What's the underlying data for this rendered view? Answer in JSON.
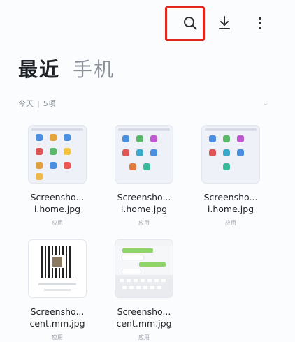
{
  "toolbar": {
    "icons": [
      "search-icon",
      "download-icon",
      "more-vertical-icon"
    ],
    "highlight_color": "#e3271f"
  },
  "tabs": [
    {
      "label": "最近",
      "active": true
    },
    {
      "label": "手机",
      "active": false
    }
  ],
  "group": {
    "date": "今天",
    "separator": "|",
    "count": "5项"
  },
  "files": [
    {
      "name_line1": "Screensho...",
      "name_line2": "i.home.jpg",
      "source": "应用",
      "thumb": "home-screen"
    },
    {
      "name_line1": "Screensho...",
      "name_line2": "i.home.jpg",
      "source": "应用",
      "thumb": "home-screen"
    },
    {
      "name_line1": "Screensho...",
      "name_line2": "i.home.jpg",
      "source": "应用",
      "thumb": "home-screen"
    },
    {
      "name_line1": "Screensho...",
      "name_line2": "cent.mm.jpg",
      "source": "应用",
      "thumb": "qr-code"
    },
    {
      "name_line1": "Screensho...",
      "name_line2": "cent.mm.jpg",
      "source": "应用",
      "thumb": "chat"
    }
  ]
}
